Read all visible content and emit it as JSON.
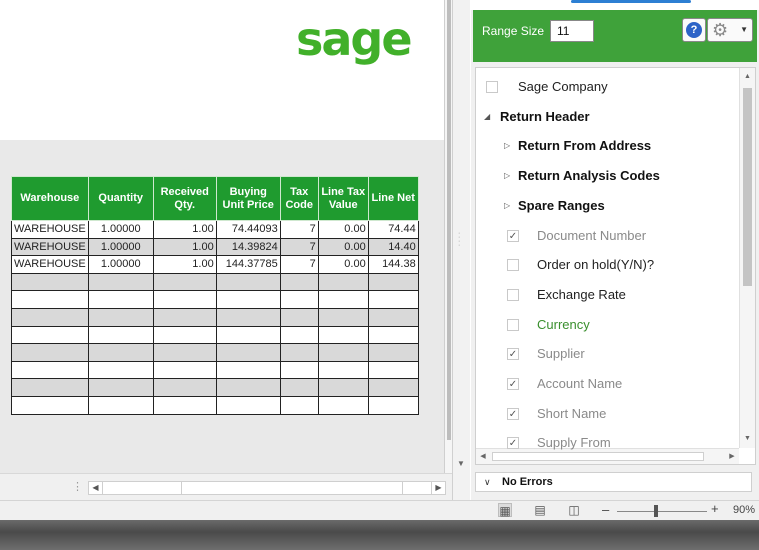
{
  "logo": {
    "text": "sage"
  },
  "grid": {
    "headers": [
      {
        "text": "Warehouse"
      },
      {
        "text": "Quantity"
      },
      {
        "text": "Received Qty."
      },
      {
        "text": "Buying Unit Price"
      },
      {
        "text": "Tax Code"
      },
      {
        "text": "Line Tax Value"
      },
      {
        "text": "Line Net"
      }
    ],
    "rows": [
      [
        "WAREHOUSE",
        "1.00000",
        "1.00",
        "74.44093",
        "7",
        "0.00",
        "74.44"
      ],
      [
        "WAREHOUSE",
        "1.00000",
        "1.00",
        "14.39824",
        "7",
        "0.00",
        "14.40"
      ],
      [
        "WAREHOUSE",
        "1.00000",
        "1.00",
        "144.37785",
        "7",
        "0.00",
        "144.38"
      ]
    ]
  },
  "panel": {
    "range_size_label": "Range Size",
    "range_size_value": "11",
    "help_glyph": "?",
    "help_icon": "help-icon",
    "settings_icon": "gear-icon",
    "tree": [
      {
        "label": "Sage Company",
        "kind": "checkbox",
        "checked": false,
        "style": "dark"
      },
      {
        "label": "Return Header",
        "kind": "expanded",
        "style": "bold"
      },
      {
        "label": "Return From Address",
        "kind": "collapsed",
        "style": "bold"
      },
      {
        "label": "Return Analysis Codes",
        "kind": "collapsed",
        "style": "bold"
      },
      {
        "label": "Spare Ranges",
        "kind": "collapsed",
        "style": "bold"
      },
      {
        "label": "Document Number",
        "kind": "checkbox",
        "checked": true,
        "style": "gray"
      },
      {
        "label": "Order on hold(Y/N)?",
        "kind": "checkbox",
        "checked": false,
        "style": "dark"
      },
      {
        "label": "Exchange Rate",
        "kind": "checkbox",
        "checked": false,
        "style": "dark"
      },
      {
        "label": "Currency",
        "kind": "checkbox",
        "checked": false,
        "style": "green"
      },
      {
        "label": "Supplier",
        "kind": "checkbox",
        "checked": true,
        "style": "gray"
      },
      {
        "label": "Account Name",
        "kind": "checkbox",
        "checked": true,
        "style": "gray"
      },
      {
        "label": "Short Name",
        "kind": "checkbox",
        "checked": true,
        "style": "gray"
      },
      {
        "label": "Supply From",
        "kind": "checkbox",
        "checked": true,
        "style": "gray"
      }
    ],
    "errors_label": "No Errors"
  },
  "statusbar": {
    "zoom_minus": "–",
    "zoom_plus": "+",
    "zoom": "90%",
    "zoom_level_percent": 90,
    "view_icons": [
      "normal-view-icon",
      "page-layout-icon",
      "page-break-preview-icon"
    ]
  },
  "colors": {
    "brand_green": "#41b02a",
    "header_green": "#1f9b2f",
    "panel_green": "#3fa23a"
  }
}
